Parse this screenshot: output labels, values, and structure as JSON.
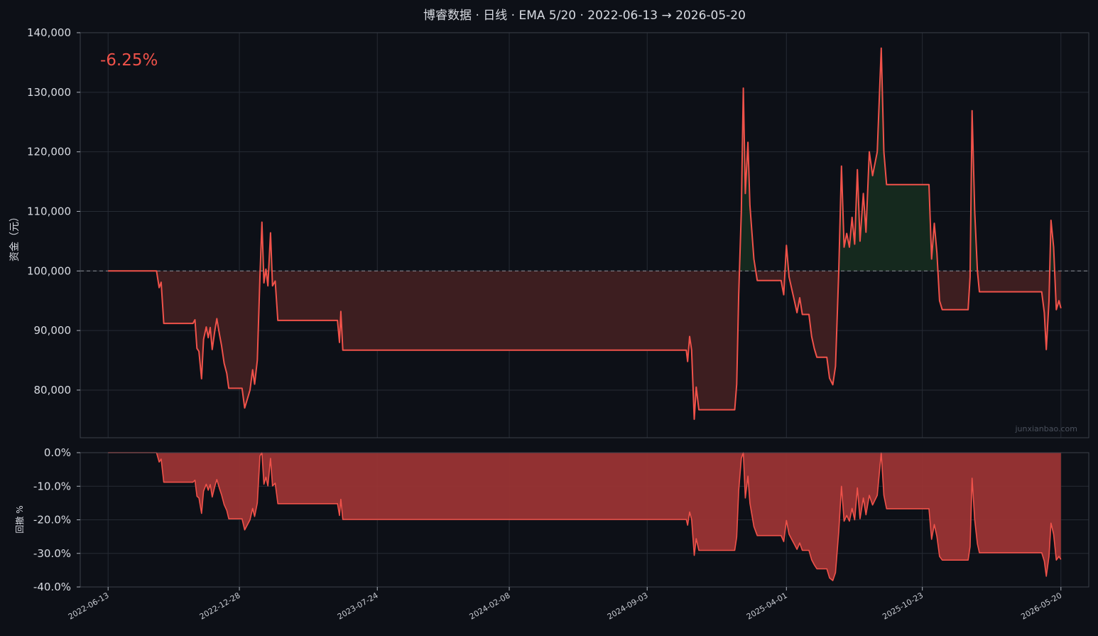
{
  "title": "博睿数据 · 日线 · EMA 5/20 · 2022-06-13 → 2026-05-20",
  "return_label": "-6.25%",
  "watermark": "junxianbao.com",
  "colors": {
    "background": "#0d1017",
    "line": "#f0524a",
    "fill_below": "#3d1e20",
    "fill_above": "#15291e",
    "drawdown_fill": "#9a3434",
    "baseline": "#8b8f98",
    "grid": "#262b34",
    "spine": "#3a3f49"
  },
  "chart_data": [
    {
      "type": "line",
      "title": "博睿数据 · 日线 · EMA 5/20 · 2022-06-13 → 2026-05-20",
      "ylabel": "资金（元）",
      "ylim": [
        72000,
        140000
      ],
      "yticks": [
        80000,
        90000,
        100000,
        110000,
        120000,
        130000,
        140000
      ],
      "ytick_labels": [
        "80,000",
        "90,000",
        "100,000",
        "110,000",
        "120,000",
        "130,000",
        "140,000"
      ],
      "baseline": 100000,
      "xlim": [
        "2022-05-02",
        "2026-07-01"
      ],
      "xticks": [
        "2022-06-13",
        "2022-12-28",
        "2023-07-24",
        "2024-02-08",
        "2024-09-03",
        "2025-04-01",
        "2025-10-23",
        "2026-05-20"
      ],
      "grid": true,
      "series": [
        {
          "points": [
            [
              "2022-06-13",
              100000
            ],
            [
              "2022-08-25",
              100000
            ],
            [
              "2022-08-29",
              97200
            ],
            [
              "2022-09-01",
              98100
            ],
            [
              "2022-09-05",
              91200
            ],
            [
              "2022-10-19",
              91200
            ],
            [
              "2022-10-22",
              91800
            ],
            [
              "2022-10-25",
              87000
            ],
            [
              "2022-10-28",
              86500
            ],
            [
              "2022-11-01",
              81900
            ],
            [
              "2022-11-04",
              88500
            ],
            [
              "2022-11-08",
              90600
            ],
            [
              "2022-11-11",
              88800
            ],
            [
              "2022-11-14",
              90500
            ],
            [
              "2022-11-17",
              86800
            ],
            [
              "2022-11-21",
              90000
            ],
            [
              "2022-11-24",
              92000
            ],
            [
              "2022-11-28",
              89300
            ],
            [
              "2022-12-01",
              87500
            ],
            [
              "2022-12-05",
              84500
            ],
            [
              "2022-12-09",
              82800
            ],
            [
              "2022-12-12",
              80300
            ],
            [
              "2023-01-01",
              80300
            ],
            [
              "2023-01-05",
              77000
            ],
            [
              "2023-01-09",
              78500
            ],
            [
              "2023-01-13",
              80000
            ],
            [
              "2023-01-17",
              83400
            ],
            [
              "2023-01-20",
              81000
            ],
            [
              "2023-01-24",
              85000
            ],
            [
              "2023-01-28",
              99000
            ],
            [
              "2023-01-31",
              108200
            ],
            [
              "2023-02-03",
              98000
            ],
            [
              "2023-02-06",
              100300
            ],
            [
              "2023-02-09",
              97500
            ],
            [
              "2023-02-13",
              106400
            ],
            [
              "2023-02-16",
              97500
            ],
            [
              "2023-02-20",
              98300
            ],
            [
              "2023-02-24",
              91700
            ],
            [
              "2023-05-25",
              91700
            ],
            [
              "2023-05-28",
              88000
            ],
            [
              "2023-05-30",
              93200
            ],
            [
              "2023-06-02",
              86700
            ],
            [
              "2024-11-01",
              86700
            ],
            [
              "2024-11-03",
              84800
            ],
            [
              "2024-11-06",
              89000
            ],
            [
              "2024-11-09",
              86700
            ],
            [
              "2024-11-13",
              75100
            ],
            [
              "2024-11-16",
              80500
            ],
            [
              "2024-11-20",
              76700
            ],
            [
              "2025-01-13",
              76700
            ],
            [
              "2025-01-16",
              81000
            ],
            [
              "2025-01-19",
              96000
            ],
            [
              "2025-01-23",
              110000
            ],
            [
              "2025-01-26",
              130700
            ],
            [
              "2025-01-29",
              113000
            ],
            [
              "2025-02-02",
              121600
            ],
            [
              "2025-02-05",
              111000
            ],
            [
              "2025-02-11",
              102000
            ],
            [
              "2025-02-16",
              98400
            ],
            [
              "2025-03-24",
              98400
            ],
            [
              "2025-03-28",
              96000
            ],
            [
              "2025-04-01",
              104300
            ],
            [
              "2025-04-05",
              99000
            ],
            [
              "2025-04-09",
              97000
            ],
            [
              "2025-04-13",
              95000
            ],
            [
              "2025-04-17",
              93000
            ],
            [
              "2025-04-21",
              95500
            ],
            [
              "2025-04-25",
              92700
            ],
            [
              "2025-05-05",
              92700
            ],
            [
              "2025-05-09",
              89000
            ],
            [
              "2025-05-13",
              87000
            ],
            [
              "2025-05-17",
              85500
            ],
            [
              "2025-06-01",
              85500
            ],
            [
              "2025-06-05",
              82000
            ],
            [
              "2025-06-10",
              80900
            ],
            [
              "2025-06-14",
              84000
            ],
            [
              "2025-06-19",
              100000
            ],
            [
              "2025-06-23",
              117600
            ],
            [
              "2025-06-27",
              104000
            ],
            [
              "2025-07-01",
              106300
            ],
            [
              "2025-07-05",
              104000
            ],
            [
              "2025-07-09",
              109000
            ],
            [
              "2025-07-13",
              104500
            ],
            [
              "2025-07-17",
              117000
            ],
            [
              "2025-07-21",
              105000
            ],
            [
              "2025-07-26",
              113000
            ],
            [
              "2025-07-30",
              106500
            ],
            [
              "2025-08-04",
              120000
            ],
            [
              "2025-08-09",
              116000
            ],
            [
              "2025-08-16",
              120000
            ],
            [
              "2025-08-22",
              137400
            ],
            [
              "2025-08-26",
              120000
            ],
            [
              "2025-08-30",
              114500
            ],
            [
              "2025-11-02",
              114500
            ],
            [
              "2025-11-06",
              102000
            ],
            [
              "2025-11-10",
              108000
            ],
            [
              "2025-11-14",
              103000
            ],
            [
              "2025-11-18",
              95000
            ],
            [
              "2025-11-22",
              93500
            ],
            [
              "2025-12-31",
              93500
            ],
            [
              "2026-01-03",
              99000
            ],
            [
              "2026-01-06",
              126900
            ],
            [
              "2026-01-10",
              110000
            ],
            [
              "2026-01-14",
              100000
            ],
            [
              "2026-01-17",
              96500
            ],
            [
              "2026-04-21",
              96500
            ],
            [
              "2026-04-25",
              93000
            ],
            [
              "2026-04-28",
              86800
            ],
            [
              "2026-05-02",
              95000
            ],
            [
              "2026-05-05",
              108500
            ],
            [
              "2026-05-09",
              104000
            ],
            [
              "2026-05-13",
              93500
            ],
            [
              "2026-05-17",
              95000
            ],
            [
              "2026-05-20",
              93750
            ]
          ]
        }
      ]
    },
    {
      "type": "area",
      "ylabel": "回撤 %",
      "ylim": [
        -40,
        0
      ],
      "yticks": [
        0,
        -10,
        -20,
        -30,
        -40
      ],
      "ytick_labels": [
        "0.0%",
        "-10.0%",
        "-20.0%",
        "-30.0%",
        "-40.0%"
      ],
      "xticks": [
        "2022-06-13",
        "2022-12-28",
        "2023-07-24",
        "2024-02-08",
        "2024-09-03",
        "2025-04-01",
        "2025-10-23",
        "2026-05-20"
      ],
      "xtick_labels": [
        "2022-06-13",
        "2022-12-28",
        "2023-07-24",
        "2024-02-08",
        "2024-09-03",
        "2025-04-01",
        "2025-10-23",
        "2026-05-20"
      ],
      "grid": true,
      "series": [
        {
          "points": [
            [
              "2022-06-13",
              0
            ],
            [
              "2022-08-25",
              0
            ],
            [
              "2022-08-29",
              -2.8
            ],
            [
              "2022-09-01",
              -1.9
            ],
            [
              "2022-09-05",
              -8.8
            ],
            [
              "2022-10-19",
              -8.8
            ],
            [
              "2022-10-22",
              -8.2
            ],
            [
              "2022-10-25",
              -13
            ],
            [
              "2022-10-28",
              -13.5
            ],
            [
              "2022-11-01",
              -18.1
            ],
            [
              "2022-11-04",
              -11.5
            ],
            [
              "2022-11-08",
              -9.4
            ],
            [
              "2022-11-11",
              -11.2
            ],
            [
              "2022-11-14",
              -9.5
            ],
            [
              "2022-11-17",
              -13.2
            ],
            [
              "2022-11-21",
              -10
            ],
            [
              "2022-11-24",
              -8
            ],
            [
              "2022-11-28",
              -10.7
            ],
            [
              "2022-12-01",
              -12.5
            ],
            [
              "2022-12-05",
              -15.5
            ],
            [
              "2022-12-09",
              -17.2
            ],
            [
              "2022-12-12",
              -19.7
            ],
            [
              "2023-01-01",
              -19.7
            ],
            [
              "2023-01-05",
              -23
            ],
            [
              "2023-01-09",
              -21.5
            ],
            [
              "2023-01-13",
              -20
            ],
            [
              "2023-01-17",
              -16.6
            ],
            [
              "2023-01-20",
              -19
            ],
            [
              "2023-01-24",
              -15
            ],
            [
              "2023-01-28",
              -1
            ],
            [
              "2023-01-31",
              0
            ],
            [
              "2023-02-03",
              -9.4
            ],
            [
              "2023-02-06",
              -7.3
            ],
            [
              "2023-02-09",
              -9.9
            ],
            [
              "2023-02-13",
              -1.7
            ],
            [
              "2023-02-16",
              -9.9
            ],
            [
              "2023-02-20",
              -9.1
            ],
            [
              "2023-02-24",
              -15.2
            ],
            [
              "2023-05-25",
              -15.2
            ],
            [
              "2023-05-28",
              -18.7
            ],
            [
              "2023-05-30",
              -13.9
            ],
            [
              "2023-06-02",
              -19.9
            ],
            [
              "2024-11-01",
              -19.9
            ],
            [
              "2024-11-03",
              -21.6
            ],
            [
              "2024-11-06",
              -17.7
            ],
            [
              "2024-11-09",
              -19.9
            ],
            [
              "2024-11-13",
              -30.6
            ],
            [
              "2024-11-16",
              -25.6
            ],
            [
              "2024-11-20",
              -29.1
            ],
            [
              "2025-01-13",
              -29.1
            ],
            [
              "2025-01-16",
              -25.1
            ],
            [
              "2025-01-19",
              -11.3
            ],
            [
              "2025-01-23",
              -1.7
            ],
            [
              "2025-01-26",
              0
            ],
            [
              "2025-01-29",
              -13.5
            ],
            [
              "2025-02-02",
              -7
            ],
            [
              "2025-02-05",
              -15.1
            ],
            [
              "2025-02-11",
              -22
            ],
            [
              "2025-02-16",
              -24.7
            ],
            [
              "2025-03-24",
              -24.7
            ],
            [
              "2025-03-28",
              -26.5
            ],
            [
              "2025-04-01",
              -20.2
            ],
            [
              "2025-04-05",
              -24.3
            ],
            [
              "2025-04-09",
              -25.8
            ],
            [
              "2025-04-13",
              -27.3
            ],
            [
              "2025-04-17",
              -28.8
            ],
            [
              "2025-04-21",
              -26.9
            ],
            [
              "2025-04-25",
              -29.1
            ],
            [
              "2025-05-05",
              -29.1
            ],
            [
              "2025-05-09",
              -31.9
            ],
            [
              "2025-05-13",
              -33.4
            ],
            [
              "2025-05-17",
              -34.6
            ],
            [
              "2025-06-01",
              -34.6
            ],
            [
              "2025-06-05",
              -37.3
            ],
            [
              "2025-06-10",
              -38.1
            ],
            [
              "2025-06-14",
              -35.7
            ],
            [
              "2025-06-19",
              -23.5
            ],
            [
              "2025-06-23",
              -10
            ],
            [
              "2025-06-27",
              -20.4
            ],
            [
              "2025-07-01",
              -18.7
            ],
            [
              "2025-07-05",
              -20.4
            ],
            [
              "2025-07-09",
              -16.6
            ],
            [
              "2025-07-13",
              -20
            ],
            [
              "2025-07-17",
              -10.5
            ],
            [
              "2025-07-21",
              -19.7
            ],
            [
              "2025-07-26",
              -13.5
            ],
            [
              "2025-07-30",
              -18.5
            ],
            [
              "2025-08-04",
              -12.7
            ],
            [
              "2025-08-09",
              -15.6
            ],
            [
              "2025-08-16",
              -12.7
            ],
            [
              "2025-08-22",
              0
            ],
            [
              "2025-08-26",
              -12.7
            ],
            [
              "2025-08-30",
              -16.7
            ],
            [
              "2025-11-02",
              -16.7
            ],
            [
              "2025-11-06",
              -25.8
            ],
            [
              "2025-11-10",
              -21.4
            ],
            [
              "2025-11-14",
              -25
            ],
            [
              "2025-11-18",
              -30.9
            ],
            [
              "2025-11-22",
              -32
            ],
            [
              "2025-12-31",
              -32
            ],
            [
              "2026-01-03",
              -28
            ],
            [
              "2026-01-06",
              -7.6
            ],
            [
              "2026-01-10",
              -20
            ],
            [
              "2026-01-14",
              -27.2
            ],
            [
              "2026-01-17",
              -29.8
            ],
            [
              "2026-04-21",
              -29.8
            ],
            [
              "2026-04-25",
              -32.3
            ],
            [
              "2026-04-28",
              -36.8
            ],
            [
              "2026-05-02",
              -30.9
            ],
            [
              "2026-05-05",
              -21
            ],
            [
              "2026-05-09",
              -24.3
            ],
            [
              "2026-05-13",
              -32
            ],
            [
              "2026-05-17",
              -30.9
            ],
            [
              "2026-05-20",
              -31.8
            ]
          ]
        }
      ]
    }
  ]
}
